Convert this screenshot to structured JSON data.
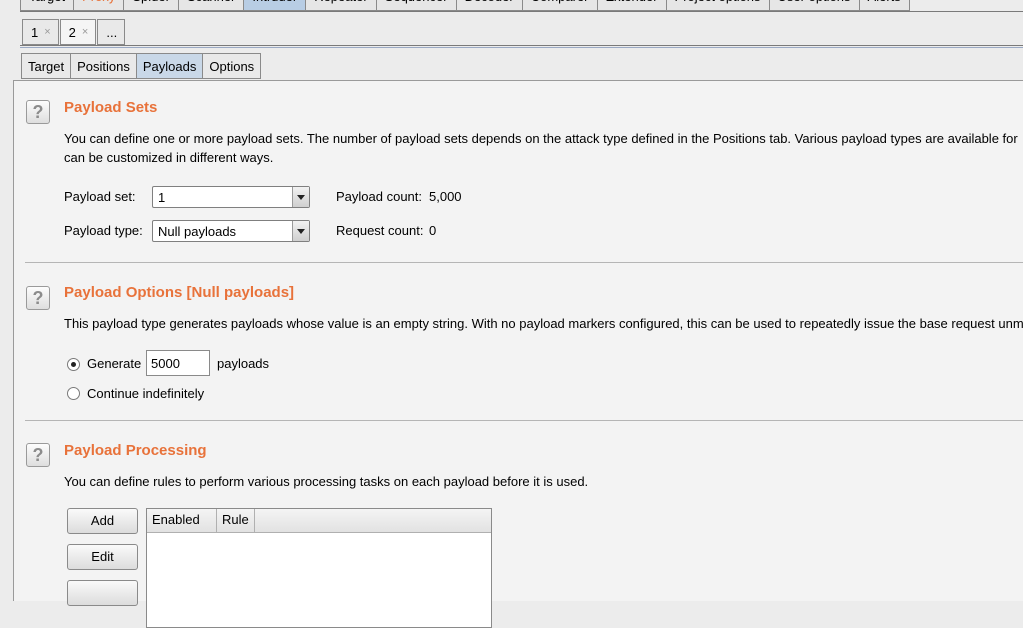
{
  "top_tabs": [
    "Target",
    "Proxy",
    "Spider",
    "Scanner",
    "Intruder",
    "Repeater",
    "Sequencer",
    "Decoder",
    "Comparer",
    "Extender",
    "Project options",
    "User options",
    "Alerts"
  ],
  "attack_tabs": {
    "tab1": "1",
    "tab2": "2",
    "more": "...",
    "close": "×"
  },
  "sub_tabs": [
    "Target",
    "Positions",
    "Payloads",
    "Options"
  ],
  "payload_sets": {
    "title": "Payload Sets",
    "desc1": "You can define one or more payload sets. The number of payload sets depends on the attack type defined in the Positions tab. Various payload types are available for",
    "desc2": "can be customized in different ways.",
    "set_label": "Payload set:",
    "set_value": "1",
    "type_label": "Payload type:",
    "type_value": "Null payloads",
    "payload_count_label": "Payload count:",
    "payload_count_value": "5,000",
    "request_count_label": "Request count:",
    "request_count_value": "0"
  },
  "payload_options": {
    "title": "Payload Options [Null payloads]",
    "desc": "This payload type generates payloads whose value is an empty string. With no payload markers configured, this can be used to repeatedly issue the base request unm",
    "generate_label": "Generate",
    "generate_value": "5000",
    "payloads_label": "payloads",
    "continue_label": "Continue indefinitely"
  },
  "payload_processing": {
    "title": "Payload Processing",
    "desc": "You can define rules to perform various processing tasks on each payload before it is used.",
    "add_label": "Add",
    "edit_label": "Edit",
    "col_enabled": "Enabled",
    "col_rule": "Rule"
  },
  "icons": {
    "help": "?"
  },
  "colors": {
    "section_title": "#e8723a",
    "active_tab": "#c9d8e8"
  }
}
